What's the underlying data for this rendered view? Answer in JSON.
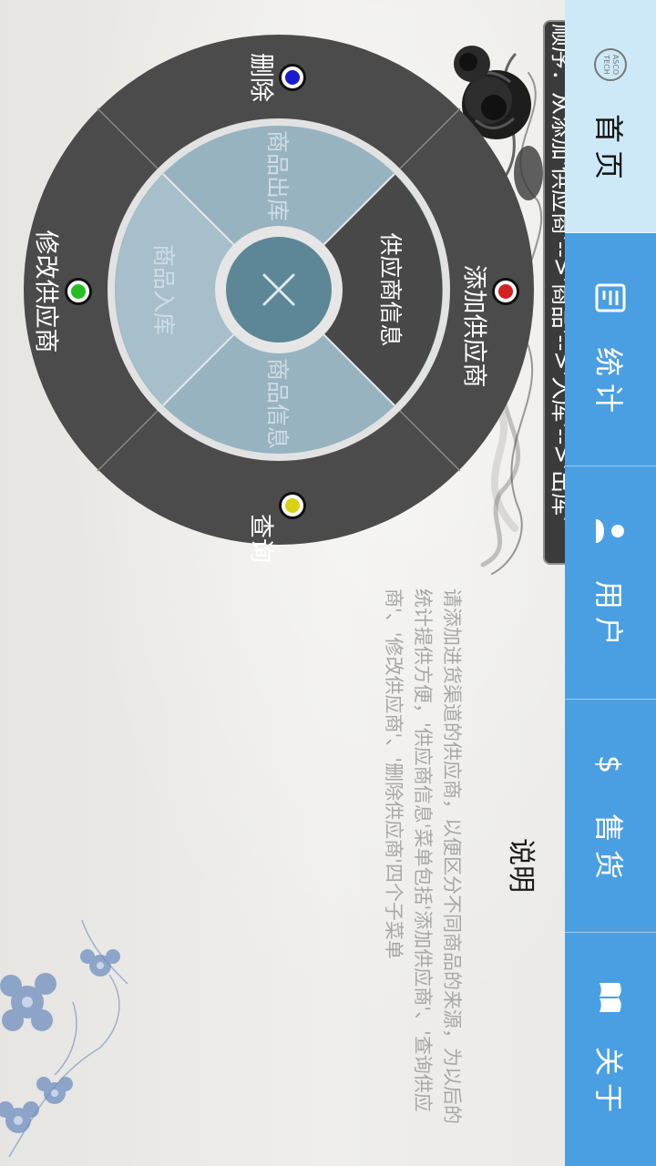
{
  "order_banner": "顺序：从添加'供应商'-->'商品'-->'入库'-->'出库'",
  "nav": {
    "items": [
      {
        "label": "首页",
        "icon": "ascotech-logo-icon",
        "active": true
      },
      {
        "label": "统计",
        "icon": "document-list-icon",
        "active": false
      },
      {
        "label": "用户",
        "icon": "user-icon",
        "active": false
      },
      {
        "label": "售货",
        "icon": "dollar-icon",
        "active": false
      },
      {
        "label": "关于",
        "icon": "book-icon",
        "active": false
      }
    ],
    "logo_text": "ASCO TECH"
  },
  "wheel": {
    "outer": {
      "add_supplier": "添加供应商",
      "query": "查询",
      "modify_supplier": "修改供应商",
      "delete": "删除"
    },
    "inner": {
      "supplier_info": "供应商信息",
      "goods_info": "商品信息",
      "goods_in": "商品入库",
      "goods_out": "商品出库"
    },
    "center_icon": "close-icon"
  },
  "help": {
    "title": "说明",
    "body": "请添加进货渠道的供应商，以便区分不同商品的来源，为以后的统计提供方便，'供应商信息'菜单包括'添加供应商'、'查询供应商'、'修改供应商'、'删除供应商'四个子菜单"
  },
  "colors": {
    "nav_blue": "#4a9fe2",
    "nav_active": "#cde9f8",
    "wheel_outer": "#4b4b4b",
    "wheel_inner_light": "#97b3bf",
    "wheel_center": "#5d8797",
    "dot_red": "#d42020",
    "dot_yellow": "#d8d214",
    "dot_green": "#22c022",
    "dot_blue": "#1a1ad0"
  }
}
